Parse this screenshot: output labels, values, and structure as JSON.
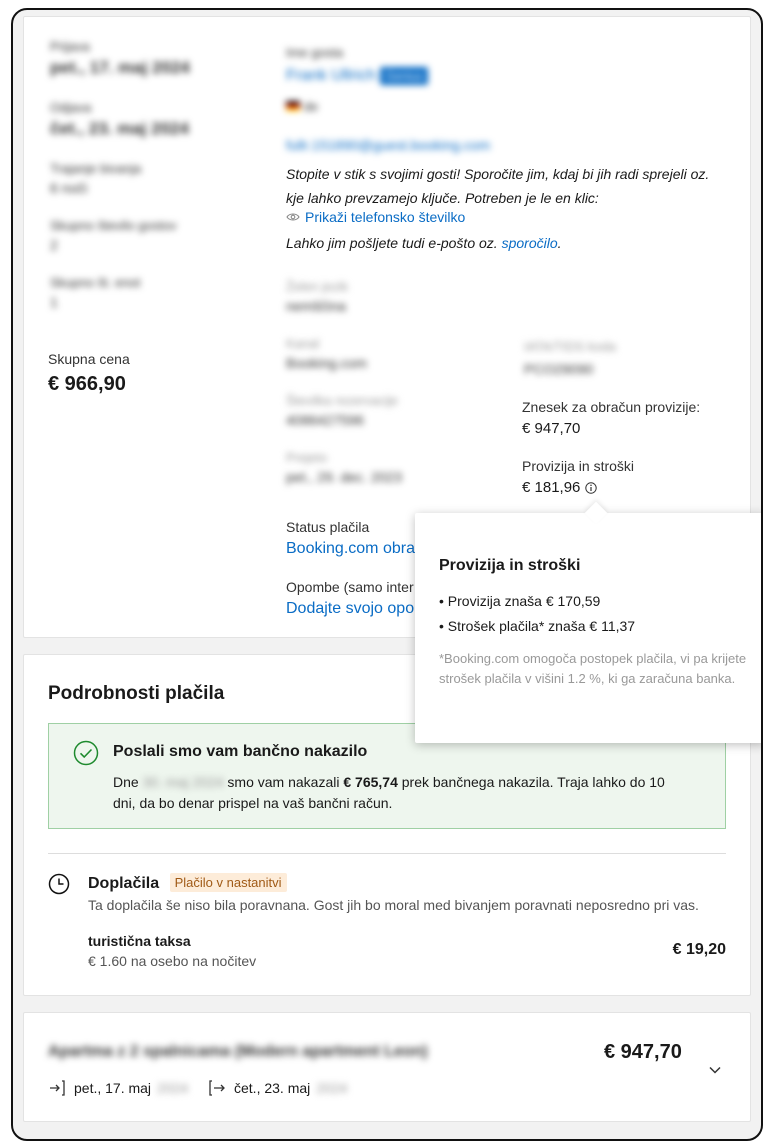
{
  "guest_info": {
    "checkin_label": "Prijava",
    "checkin_value": "pet., 17. maj 2024",
    "checkout_label": "Odjava",
    "checkout_value": "čet., 23. maj 2024",
    "length_label": "Trajanje bivanja",
    "length_value": "6 noči",
    "guests_label": "Skupno število gostov",
    "guests_value": "2",
    "units_label": "Skupno št. enot",
    "units_value": "1",
    "total_price_label": "Skupna cena",
    "total_price_value": "€ 966,90"
  },
  "guest": {
    "name_label": "Ime gosta",
    "name_value": "Frank Ullrich",
    "genius_badge": "Genius",
    "country": "de",
    "email": "fullr.151890@guest.booking.com",
    "contact_text_1": "Stopite v stik s svojimi gosti! Sporočite jim, kdaj bi jih radi sprejeli oz.",
    "contact_text_2": "kje lahko prevzamejo ključe. Potreben je le en klic:",
    "show_phone_link": "Prikaži telefonsko številko",
    "email_text_prefix": "Lahko jim pošljete tudi e-pošto oz.",
    "message_link": "sporočilo",
    "email_text_suffix": "."
  },
  "booking": {
    "language_label": "Želen jezik",
    "language_value": "nemščina",
    "channel_label": "Kanal",
    "channel_value": "Booking.com",
    "reservation_number_label": "Številka rezervacije",
    "reservation_number_value": "4086427596",
    "received_label": "Prejeto",
    "received_value": "pet., 29. dec. 2023",
    "payment_status_label": "Status plačila",
    "payment_status_value": "Booking.com obra",
    "notes_label": "Opombe (samo inter",
    "notes_link": "Dodajte svojo opo",
    "vat_label": "IATA/TIDS koda",
    "vat_value": "PCO29090",
    "commissionable_label": "Znesek za obračun provizije:",
    "commissionable_value": "€ 947,70",
    "commission_label": "Provizija in stroški",
    "commission_value": "€ 181,96",
    "info_icon": "info-icon"
  },
  "tooltip": {
    "title": "Provizija in stroški",
    "items": [
      "Provizija znaša € 170,59",
      "Strošek plačila* znaša € 11,37"
    ],
    "note": "*Booking.com omogoča postopek plačila, vi pa krijete strošek plačila v višini 1.2 %, ki ga zaračuna banka."
  },
  "payment": {
    "title": "Podrobnosti plačila",
    "alert_title": "Poslali smo vam bančno nakazilo",
    "alert_prefix": "Dne",
    "alert_date": "30. maj 2024",
    "alert_middle": "smo vam nakazali",
    "alert_amount": "€ 765,74",
    "alert_suffix_1": "prek bančnega nakazila. Traja lahko do 10",
    "alert_suffix_2": "dni, da bo denar prispel na vaš bančni račun.",
    "surcharges_title": "Doplačila",
    "surcharges_badge": "Plačilo v nastanitvi",
    "surcharges_desc": "Ta doplačila še niso bila poravnana. Gost jih bo moral med bivanjem poravnati neposredno pri vas.",
    "tax_title": "turistična taksa",
    "tax_desc": "€ 1.60 na osebo na nočitev",
    "tax_amount": "€ 19,20"
  },
  "room": {
    "name": "Apartma z 2 spalnicama (Modern apartment Leon)",
    "price": "€ 947,70",
    "checkin_prefix": "pet., 17. maj",
    "checkin_year": "2024",
    "checkout_prefix": "čet., 23. maj",
    "checkout_year": "2024"
  },
  "colors": {
    "link": "#0a6cc5",
    "success_border": "#9fd0a4",
    "success_bg": "#eef6ee",
    "badge_bg": "#fdecd9",
    "badge_text": "#a05a16"
  }
}
